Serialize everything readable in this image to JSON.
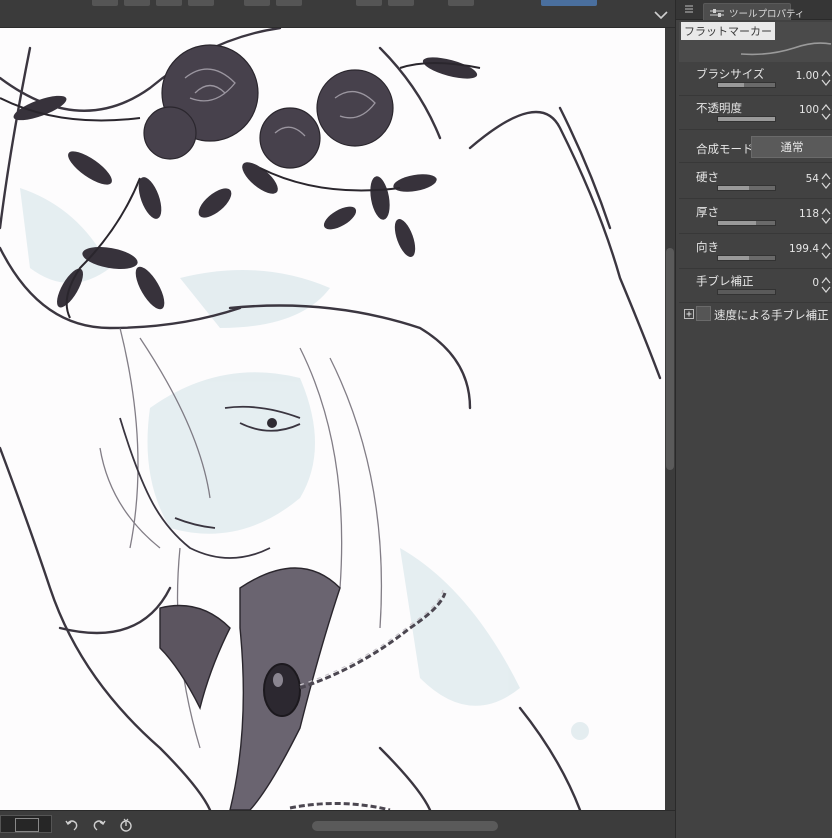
{
  "panel": {
    "tab_label": "ツールプロパティ",
    "brush_name": "フラットマーカー",
    "properties": [
      {
        "label": "ブラシサイズ",
        "value": "1.00",
        "level": 0.45
      },
      {
        "label": "不透明度",
        "value": "100",
        "level": 1.0
      },
      {
        "label": "硬さ",
        "value": "54",
        "level": 0.54
      },
      {
        "label": "厚さ",
        "value": "118",
        "level": 0.66
      },
      {
        "label": "向き",
        "value": "199.4",
        "level": 0.55
      },
      {
        "label": "手ブレ補正",
        "value": "0",
        "level": 0.0
      }
    ],
    "blend_mode": {
      "label": "合成モード",
      "value": "通常"
    },
    "stabilization": {
      "label": "速度による手ブレ補正"
    }
  },
  "colors": {
    "ui_dark": "#3a3a3a",
    "panel_bg": "#424242",
    "canvas_bg": "#ffffff",
    "accent_tab": "#4a6f9e"
  },
  "icons": {
    "panel_menu": "menu-icon",
    "tab": "sliders-icon",
    "collapse": "chevron-down-icon",
    "undo": "undo-icon",
    "redo": "redo-icon",
    "rotate_reset": "rotate-reset-icon"
  }
}
